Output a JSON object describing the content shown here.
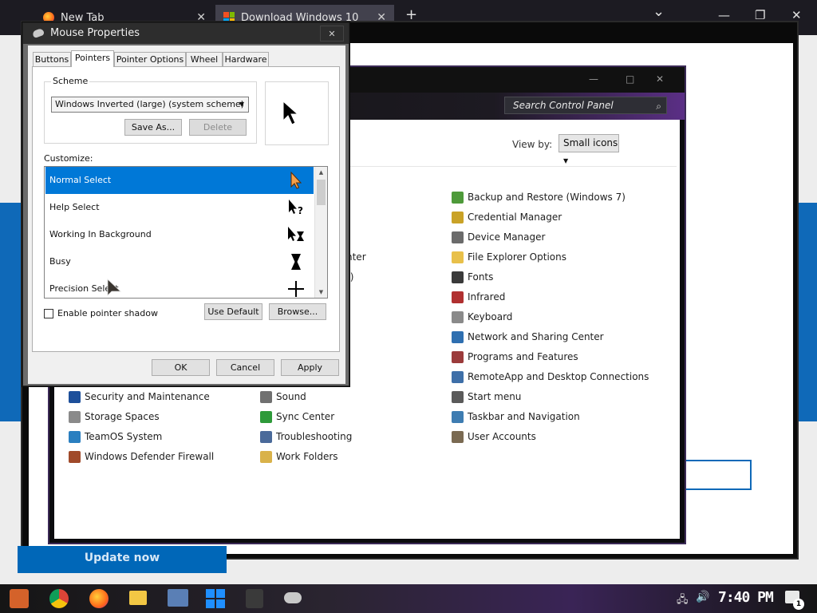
{
  "browser": {
    "tabs": [
      {
        "title": "New Tab"
      },
      {
        "title": "Download Windows 10"
      }
    ],
    "new_tab_symbol": "+",
    "dropdown_symbol": "⌄",
    "minimize_symbol": "—",
    "restore_symbol": "❐",
    "close_symbol": "✕",
    "page_button": "Update now"
  },
  "control_panel": {
    "search_placeholder": "Search Control Panel",
    "view_by_label": "View by:",
    "view_by_value": "Small icons",
    "items": [
      {
        "label": "Backup and Restore (Windows 7)",
        "icon": "backup-icon",
        "color": "#4e9a3a"
      },
      {
        "label": "Credential Manager",
        "icon": "credential-icon",
        "color": "#c9a227"
      },
      {
        "label": "Device Manager",
        "icon": "device-manager-icon",
        "color": "#6b6b6b"
      },
      {
        "label": "File Explorer Options",
        "icon": "folder-icon",
        "color": "#e8c04a"
      },
      {
        "label": "Fonts",
        "icon": "fonts-icon",
        "color": "#3a3a3a"
      },
      {
        "label": "Infrared",
        "icon": "infrared-icon",
        "color": "#b03030"
      },
      {
        "label": "Keyboard",
        "icon": "keyboard-icon",
        "color": "#8a8a8a"
      },
      {
        "label": "Network and Sharing Center",
        "icon": "network-icon",
        "color": "#2f6fb0"
      },
      {
        "label": "Programs and Features",
        "icon": "programs-icon",
        "color": "#9b3b3b"
      },
      {
        "label": "RemoteApp and Desktop Connections",
        "icon": "remoteapp-icon",
        "color": "#3e6fa8"
      },
      {
        "label": "Start menu",
        "icon": "start-menu-icon",
        "color": "#5a5a5a"
      },
      {
        "label": "Taskbar and Navigation",
        "icon": "taskbar-icon",
        "color": "#3e7cb1"
      },
      {
        "label": "User Accounts",
        "icon": "user-accounts-icon",
        "color": "#7a6a52"
      },
      {
        "label": "Security and Maintenance",
        "icon": "flag-icon",
        "color": "#1d4f9a"
      },
      {
        "label": "Sound",
        "icon": "sound-icon",
        "color": "#707070"
      },
      {
        "label": "Storage Spaces",
        "icon": "storage-icon",
        "color": "#8a8a8a"
      },
      {
        "label": "Sync Center",
        "icon": "sync-icon",
        "color": "#2e9a3a"
      },
      {
        "label": "TeamOS System",
        "icon": "monitor-icon",
        "color": "#2a7fc0"
      },
      {
        "label": "Troubleshooting",
        "icon": "troubleshooting-icon",
        "color": "#4a6a9a"
      },
      {
        "label": "Windows Defender Firewall",
        "icon": "firewall-icon",
        "color": "#a04a2a"
      },
      {
        "label": "Work Folders",
        "icon": "work-folders-icon",
        "color": "#d9b24a"
      }
    ],
    "partial_items": [
      "nter",
      "t)"
    ]
  },
  "mouse_properties": {
    "title": "Mouse Properties",
    "close": "✕",
    "tabs": [
      "Buttons",
      "Pointers",
      "Pointer Options",
      "Wheel",
      "Hardware"
    ],
    "active_tab": "Pointers",
    "scheme_label": "Scheme",
    "scheme_value": "Windows Inverted (large) (system scheme)",
    "save_as": "Save As...",
    "delete": "Delete",
    "customize_label": "Customize:",
    "pointers": [
      {
        "label": "Normal Select",
        "icon": "normal-select-cursor-icon",
        "selected": true
      },
      {
        "label": "Help Select",
        "icon": "help-select-cursor-icon",
        "selected": false
      },
      {
        "label": "Working In Background",
        "icon": "working-cursor-icon",
        "selected": false
      },
      {
        "label": "Busy",
        "icon": "busy-cursor-icon",
        "selected": false
      },
      {
        "label": "Precision Select",
        "icon": "precision-cursor-icon",
        "selected": false
      }
    ],
    "enable_shadow_label": "Enable pointer shadow",
    "enable_shadow_checked": false,
    "use_default": "Use Default",
    "browse": "Browse...",
    "ok": "OK",
    "cancel": "Cancel",
    "apply": "Apply",
    "accent_color": "#0078d7"
  },
  "taskbar": {
    "clock": "7:40 PM",
    "notification_count": "1",
    "apps": [
      "start-icon",
      "chrome-icon",
      "firefox-icon",
      "file-explorer-icon",
      "computer-icon",
      "windows-icon",
      "figure-icon",
      "mouse-icon"
    ]
  }
}
